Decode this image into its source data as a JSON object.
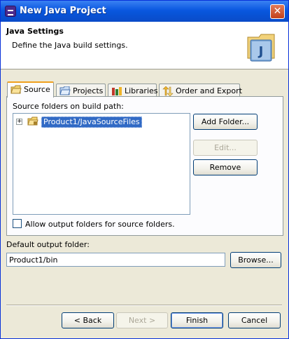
{
  "window": {
    "title": "New Java Project",
    "close_glyph": "✕"
  },
  "header": {
    "title": "Java Settings",
    "description": "Define the Java build settings.",
    "banner_letter": "J"
  },
  "tabs": [
    {
      "label": "Source",
      "icon": "source-folder-icon",
      "active": true
    },
    {
      "label": "Projects",
      "icon": "projects-icon",
      "active": false
    },
    {
      "label": "Libraries",
      "icon": "libraries-icon",
      "active": false
    },
    {
      "label": "Order and Export",
      "icon": "order-export-icon",
      "active": false
    }
  ],
  "source": {
    "folders_label": "Source folders on build path:",
    "tree": [
      {
        "label": "Product1/JavaSourceFiles",
        "expander": "+",
        "selected": true
      }
    ],
    "buttons": {
      "add_folder": "Add Folder...",
      "edit": "Edit...",
      "remove": "Remove"
    },
    "allow_output_label": "Allow output folders for source folders.",
    "allow_output_checked": false
  },
  "output": {
    "label": "Default output folder:",
    "value": "Product1/bin",
    "browse": "Browse..."
  },
  "footer": {
    "back": "< Back",
    "next": "Next >",
    "finish": "Finish",
    "cancel": "Cancel"
  },
  "colors": {
    "titlebar": "#0a58e0",
    "dialog_bg": "#ece9d8",
    "selection": "#316ac5",
    "active_tab_accent": "#f0a01e"
  }
}
